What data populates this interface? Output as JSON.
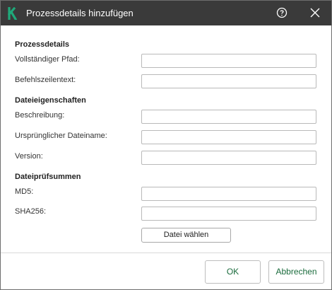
{
  "window": {
    "title": "Prozessdetails hinzufügen",
    "logo_letter": "K",
    "accent_color": "#1fa97a"
  },
  "icons": {
    "logo": "kaspersky-logo-icon",
    "help": "help-circle-icon",
    "close": "close-icon"
  },
  "process_details": {
    "heading": "Prozessdetails",
    "full_path_label": "Vollständiger Pfad:",
    "full_path_value": "",
    "command_line_label": "Befehlszeilentext:",
    "command_line_value": ""
  },
  "file_properties": {
    "heading": "Dateieigenschaften",
    "description_label": "Beschreibung:",
    "description_value": "",
    "original_name_label": "Ursprünglicher Dateiname:",
    "original_name_value": "",
    "version_label": "Version:",
    "version_value": ""
  },
  "checksums": {
    "heading": "Dateiprüfsummen",
    "md5_label": "MD5:",
    "md5_value": "",
    "sha256_label": "SHA256:",
    "sha256_value": "",
    "choose_file_label": "Datei wählen"
  },
  "footer": {
    "ok_label": "OK",
    "cancel_label": "Abbrechen"
  }
}
